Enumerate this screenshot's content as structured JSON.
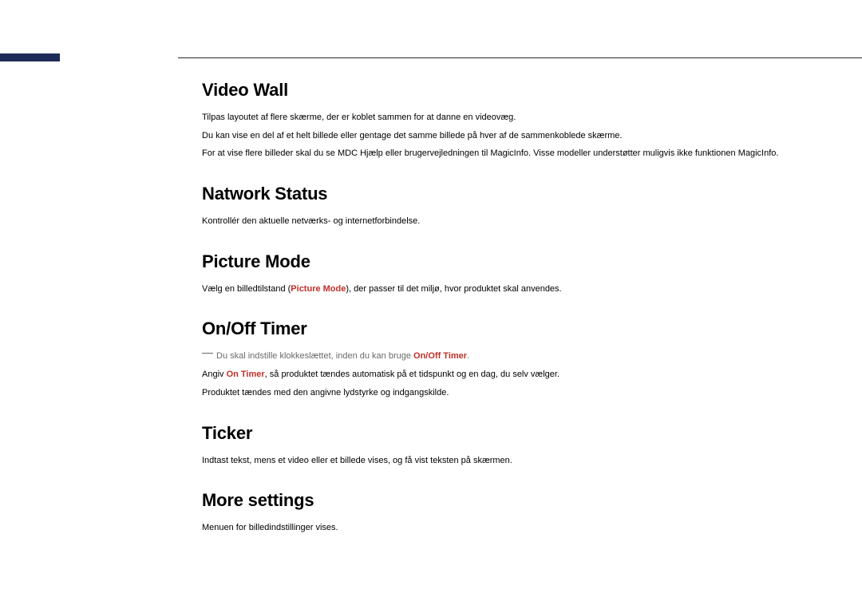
{
  "sections": {
    "videoWall": {
      "heading": "Video Wall",
      "p1": "Tilpas layoutet af flere skærme, der er koblet sammen for at danne en videovæg.",
      "p2": "Du kan vise en del af et helt billede eller gentage det samme billede på hver af de sammenkoblede skærme.",
      "p3": "For at vise flere billeder skal du se MDC Hjælp eller brugervejledningen til MagicInfo. Visse modeller understøtter muligvis ikke funktionen MagicInfo."
    },
    "networkStatus": {
      "heading": "Natwork Status",
      "p1": "Kontrollér den aktuelle netværks- og internetforbindelse."
    },
    "pictureMode": {
      "heading": "Picture Mode",
      "p1_pre": "Vælg en billedtilstand (",
      "p1_accent": "Picture Mode",
      "p1_post": "), der passer til det miljø, hvor produktet skal anvendes."
    },
    "onOffTimer": {
      "heading": "On/Off Timer",
      "note_pre": "Du skal indstille klokkeslættet, inden du kan bruge ",
      "note_accent": "On/Off Timer",
      "note_post": ".",
      "p2_pre": "Angiv ",
      "p2_accent": "On Timer",
      "p2_post": ", så produktet tændes automatisk på et tidspunkt og en dag, du selv vælger.",
      "p3": "Produktet tændes med den angivne lydstyrke og indgangskilde."
    },
    "ticker": {
      "heading": "Ticker",
      "p1": "Indtast tekst, mens et video eller et billede vises, og få vist teksten på skærmen."
    },
    "moreSettings": {
      "heading": "More settings",
      "p1": "Menuen for billedindstillinger vises."
    }
  }
}
